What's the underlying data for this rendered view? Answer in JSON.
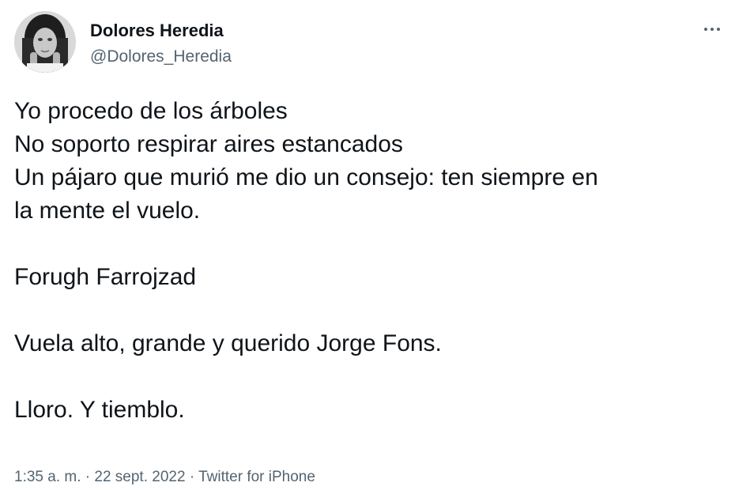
{
  "author": {
    "display_name": "Dolores Heredia",
    "handle": "@Dolores_Heredia"
  },
  "tweet": {
    "lines": [
      "Yo procedo de los árboles",
      "No soporto respirar aires estancados",
      "Un pájaro que murió me dio un consejo: ten siempre en",
      "la mente el vuelo.",
      "",
      "Forugh Farrojzad",
      "",
      "Vuela alto, grande y querido Jorge Fons.",
      "",
      "Lloro. Y tiemblo."
    ]
  },
  "meta": {
    "time": "1:35 a. m.",
    "separator": "·",
    "date": "22 sept. 2022",
    "source": "Twitter for iPhone"
  },
  "icons": {
    "more": "more-horizontal-icon",
    "avatar": "profile-photo"
  },
  "colors": {
    "text": "#0f1419",
    "secondary": "#536471",
    "background": "#ffffff"
  }
}
